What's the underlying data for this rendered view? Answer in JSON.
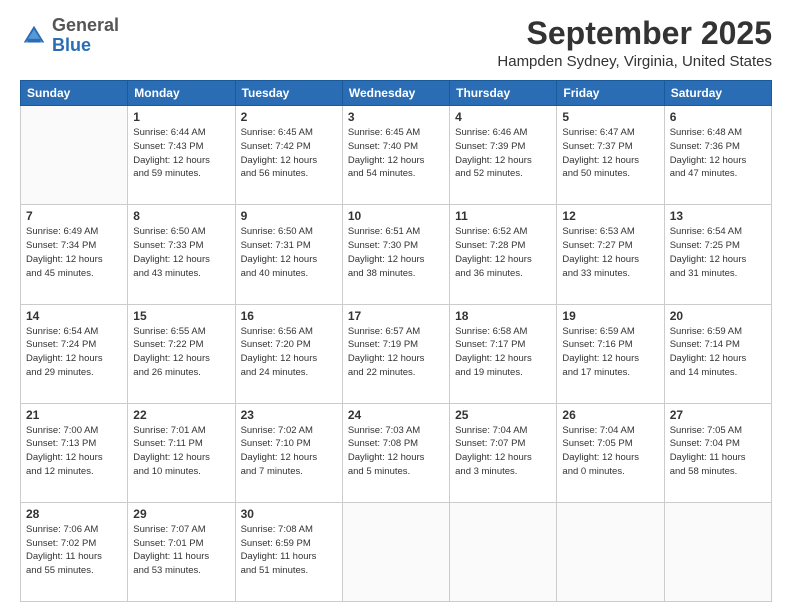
{
  "header": {
    "logo": {
      "general": "General",
      "blue": "Blue"
    },
    "title": "September 2025",
    "location": "Hampden Sydney, Virginia, United States"
  },
  "weekdays": [
    "Sunday",
    "Monday",
    "Tuesday",
    "Wednesday",
    "Thursday",
    "Friday",
    "Saturday"
  ],
  "weeks": [
    [
      {
        "day": "",
        "info": ""
      },
      {
        "day": "1",
        "info": "Sunrise: 6:44 AM\nSunset: 7:43 PM\nDaylight: 12 hours\nand 59 minutes."
      },
      {
        "day": "2",
        "info": "Sunrise: 6:45 AM\nSunset: 7:42 PM\nDaylight: 12 hours\nand 56 minutes."
      },
      {
        "day": "3",
        "info": "Sunrise: 6:45 AM\nSunset: 7:40 PM\nDaylight: 12 hours\nand 54 minutes."
      },
      {
        "day": "4",
        "info": "Sunrise: 6:46 AM\nSunset: 7:39 PM\nDaylight: 12 hours\nand 52 minutes."
      },
      {
        "day": "5",
        "info": "Sunrise: 6:47 AM\nSunset: 7:37 PM\nDaylight: 12 hours\nand 50 minutes."
      },
      {
        "day": "6",
        "info": "Sunrise: 6:48 AM\nSunset: 7:36 PM\nDaylight: 12 hours\nand 47 minutes."
      }
    ],
    [
      {
        "day": "7",
        "info": "Sunrise: 6:49 AM\nSunset: 7:34 PM\nDaylight: 12 hours\nand 45 minutes."
      },
      {
        "day": "8",
        "info": "Sunrise: 6:50 AM\nSunset: 7:33 PM\nDaylight: 12 hours\nand 43 minutes."
      },
      {
        "day": "9",
        "info": "Sunrise: 6:50 AM\nSunset: 7:31 PM\nDaylight: 12 hours\nand 40 minutes."
      },
      {
        "day": "10",
        "info": "Sunrise: 6:51 AM\nSunset: 7:30 PM\nDaylight: 12 hours\nand 38 minutes."
      },
      {
        "day": "11",
        "info": "Sunrise: 6:52 AM\nSunset: 7:28 PM\nDaylight: 12 hours\nand 36 minutes."
      },
      {
        "day": "12",
        "info": "Sunrise: 6:53 AM\nSunset: 7:27 PM\nDaylight: 12 hours\nand 33 minutes."
      },
      {
        "day": "13",
        "info": "Sunrise: 6:54 AM\nSunset: 7:25 PM\nDaylight: 12 hours\nand 31 minutes."
      }
    ],
    [
      {
        "day": "14",
        "info": "Sunrise: 6:54 AM\nSunset: 7:24 PM\nDaylight: 12 hours\nand 29 minutes."
      },
      {
        "day": "15",
        "info": "Sunrise: 6:55 AM\nSunset: 7:22 PM\nDaylight: 12 hours\nand 26 minutes."
      },
      {
        "day": "16",
        "info": "Sunrise: 6:56 AM\nSunset: 7:20 PM\nDaylight: 12 hours\nand 24 minutes."
      },
      {
        "day": "17",
        "info": "Sunrise: 6:57 AM\nSunset: 7:19 PM\nDaylight: 12 hours\nand 22 minutes."
      },
      {
        "day": "18",
        "info": "Sunrise: 6:58 AM\nSunset: 7:17 PM\nDaylight: 12 hours\nand 19 minutes."
      },
      {
        "day": "19",
        "info": "Sunrise: 6:59 AM\nSunset: 7:16 PM\nDaylight: 12 hours\nand 17 minutes."
      },
      {
        "day": "20",
        "info": "Sunrise: 6:59 AM\nSunset: 7:14 PM\nDaylight: 12 hours\nand 14 minutes."
      }
    ],
    [
      {
        "day": "21",
        "info": "Sunrise: 7:00 AM\nSunset: 7:13 PM\nDaylight: 12 hours\nand 12 minutes."
      },
      {
        "day": "22",
        "info": "Sunrise: 7:01 AM\nSunset: 7:11 PM\nDaylight: 12 hours\nand 10 minutes."
      },
      {
        "day": "23",
        "info": "Sunrise: 7:02 AM\nSunset: 7:10 PM\nDaylight: 12 hours\nand 7 minutes."
      },
      {
        "day": "24",
        "info": "Sunrise: 7:03 AM\nSunset: 7:08 PM\nDaylight: 12 hours\nand 5 minutes."
      },
      {
        "day": "25",
        "info": "Sunrise: 7:04 AM\nSunset: 7:07 PM\nDaylight: 12 hours\nand 3 minutes."
      },
      {
        "day": "26",
        "info": "Sunrise: 7:04 AM\nSunset: 7:05 PM\nDaylight: 12 hours\nand 0 minutes."
      },
      {
        "day": "27",
        "info": "Sunrise: 7:05 AM\nSunset: 7:04 PM\nDaylight: 11 hours\nand 58 minutes."
      }
    ],
    [
      {
        "day": "28",
        "info": "Sunrise: 7:06 AM\nSunset: 7:02 PM\nDaylight: 11 hours\nand 55 minutes."
      },
      {
        "day": "29",
        "info": "Sunrise: 7:07 AM\nSunset: 7:01 PM\nDaylight: 11 hours\nand 53 minutes."
      },
      {
        "day": "30",
        "info": "Sunrise: 7:08 AM\nSunset: 6:59 PM\nDaylight: 11 hours\nand 51 minutes."
      },
      {
        "day": "",
        "info": ""
      },
      {
        "day": "",
        "info": ""
      },
      {
        "day": "",
        "info": ""
      },
      {
        "day": "",
        "info": ""
      }
    ]
  ]
}
